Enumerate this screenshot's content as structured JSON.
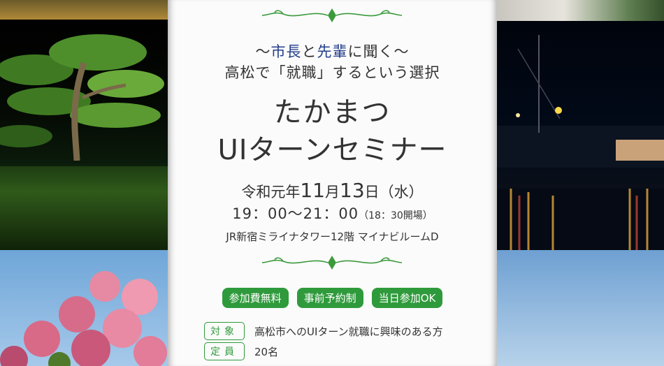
{
  "header": {
    "subtitle_prefix": "〜",
    "subtitle_mayor": "市長",
    "subtitle_and": "と",
    "subtitle_senior": "先輩",
    "subtitle_rest": "に聞く〜",
    "subtitle_line2": "高松で「就職」するという選択"
  },
  "title": {
    "line1": "たかまつ",
    "line2": "UIターンセミナー"
  },
  "event": {
    "era": "令和元年",
    "month_day_month": "11",
    "month_label": "月",
    "day": "13",
    "day_label": "日",
    "weekday": "（水）",
    "time": "19：00〜21：00",
    "doors": "（18：30開場）",
    "venue": "JR新宿ミライナタワー12階 マイナビルームD"
  },
  "badges": [
    "参加費無料",
    "事前予約制",
    "当日参加OK"
  ],
  "details": [
    {
      "label": "対象",
      "value": "高松市へのUIターン就職に興味のある方"
    },
    {
      "label": "定員",
      "value": "20名"
    }
  ],
  "colors": {
    "accent_green": "#2f9a3c",
    "highlight_blue": "#233d8a",
    "text": "#333333"
  }
}
